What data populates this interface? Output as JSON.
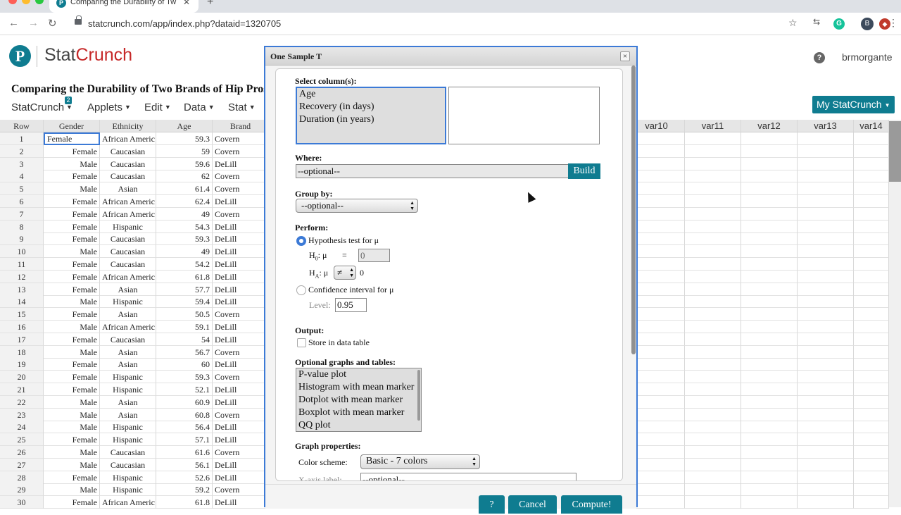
{
  "browser": {
    "tab_title": "Comparing the Durability of Tw",
    "favicon": "P",
    "url": "statcrunch.com/app/index.php?dataid=1320705",
    "profile_initial": "B",
    "extension_g": "G"
  },
  "app": {
    "logo_mark": "P",
    "logo_stat": "Stat",
    "logo_crunch": "Crunch",
    "help": "?",
    "username": "brmorgante",
    "dataset_title": "Comparing the Durability of Two Brands of Hip Prosthe",
    "menu": [
      {
        "label": "StatCrunch"
      },
      {
        "label": "Applets"
      },
      {
        "label": "Edit"
      },
      {
        "label": "Data"
      },
      {
        "label": "Stat"
      }
    ],
    "menu_badge": "2",
    "my_statcrunch": "My StatCrunch"
  },
  "grid": {
    "headers": [
      "Row",
      "Gender",
      "Ethnicity",
      "Age",
      "Brand"
    ],
    "right_headers": [
      "var10",
      "var11",
      "var12",
      "var13",
      "var14"
    ],
    "rows": [
      [
        "1",
        "Female",
        "African Americ",
        "59.3",
        "Covern"
      ],
      [
        "2",
        "Female",
        "Caucasian",
        "59",
        "Covern"
      ],
      [
        "3",
        "Male",
        "Caucasian",
        "59.6",
        "DeLill"
      ],
      [
        "4",
        "Female",
        "Caucasian",
        "62",
        "Covern"
      ],
      [
        "5",
        "Male",
        "Asian",
        "61.4",
        "Covern"
      ],
      [
        "6",
        "Female",
        "African Americ",
        "62.4",
        "DeLill"
      ],
      [
        "7",
        "Female",
        "African Americ",
        "49",
        "Covern"
      ],
      [
        "8",
        "Female",
        "Hispanic",
        "54.3",
        "DeLill"
      ],
      [
        "9",
        "Female",
        "Caucasian",
        "59.3",
        "DeLill"
      ],
      [
        "10",
        "Male",
        "Caucasian",
        "49",
        "DeLill"
      ],
      [
        "11",
        "Female",
        "Caucasian",
        "54.2",
        "DeLill"
      ],
      [
        "12",
        "Female",
        "African Americ",
        "61.8",
        "DeLill"
      ],
      [
        "13",
        "Female",
        "Asian",
        "57.7",
        "DeLill"
      ],
      [
        "14",
        "Male",
        "Hispanic",
        "59.4",
        "DeLill"
      ],
      [
        "15",
        "Female",
        "Asian",
        "50.5",
        "Covern"
      ],
      [
        "16",
        "Male",
        "African Americ",
        "59.1",
        "DeLill"
      ],
      [
        "17",
        "Female",
        "Caucasian",
        "54",
        "DeLill"
      ],
      [
        "18",
        "Male",
        "Asian",
        "56.7",
        "Covern"
      ],
      [
        "19",
        "Female",
        "Asian",
        "60",
        "DeLill"
      ],
      [
        "20",
        "Female",
        "Hispanic",
        "59.3",
        "Covern"
      ],
      [
        "21",
        "Female",
        "Hispanic",
        "52.1",
        "DeLill"
      ],
      [
        "22",
        "Male",
        "Asian",
        "60.9",
        "DeLill"
      ],
      [
        "23",
        "Male",
        "Asian",
        "60.8",
        "Covern"
      ],
      [
        "24",
        "Male",
        "Hispanic",
        "56.4",
        "DeLill"
      ],
      [
        "25",
        "Female",
        "Hispanic",
        "57.1",
        "DeLill"
      ],
      [
        "26",
        "Male",
        "Caucasian",
        "61.6",
        "Covern"
      ],
      [
        "27",
        "Male",
        "Caucasian",
        "56.1",
        "DeLill"
      ],
      [
        "28",
        "Female",
        "Hispanic",
        "52.6",
        "DeLill"
      ],
      [
        "29",
        "Male",
        "Hispanic",
        "59.2",
        "Covern"
      ],
      [
        "30",
        "Female",
        "African Americ",
        "61.8",
        "DeLill"
      ]
    ]
  },
  "dialog": {
    "title": "One Sample T",
    "close": "×",
    "select_columns_label": "Select column(s):",
    "columns": [
      "Age",
      "Recovery (in days)",
      "Duration (in years)"
    ],
    "where_label": "Where:",
    "where_placeholder": "--optional--",
    "build_button": "Build",
    "group_by_label": "Group by:",
    "group_by_value": "--optional--",
    "perform_label": "Perform:",
    "hypothesis_option": "Hypothesis test for μ",
    "h0_label": "H",
    "h0_sub": "0",
    "h0_mu": ": μ",
    "h0_eq": "=",
    "h0_value": "0",
    "ha_label": "H",
    "ha_sub": "A",
    "ha_mu": ": μ",
    "ha_operator": "≠",
    "ha_value": "0",
    "ci_option": "Confidence interval for μ",
    "level_label": "Level:",
    "level_value": "0.95",
    "output_label": "Output:",
    "store_label": "Store in data table",
    "optional_graphs_label": "Optional graphs and tables:",
    "optional_graphs": [
      "P-value plot",
      "Histogram with mean marker",
      "Dotplot with mean marker",
      "Boxplot with mean marker",
      "QQ plot"
    ],
    "graph_properties_label": "Graph properties:",
    "color_scheme_label": "Color scheme:",
    "color_scheme_value": "Basic - 7 colors",
    "xaxis_label": "X-axis label:",
    "xaxis_placeholder": "--optional--",
    "help_button": "?",
    "cancel_button": "Cancel",
    "compute_button": "Compute!"
  },
  "colors": {
    "brand_teal": "#0f7c90",
    "logo_red": "#c62828",
    "selection_blue": "#3c7ad6"
  }
}
